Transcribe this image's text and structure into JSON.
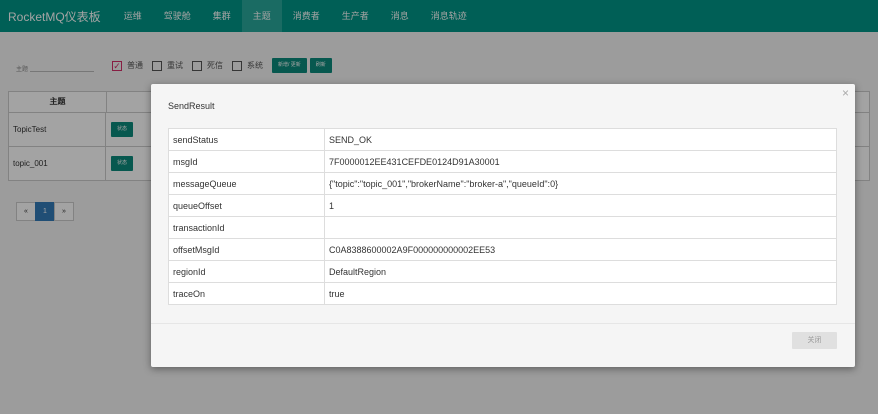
{
  "navbar": {
    "brand": "RocketMQ仪表板",
    "items": [
      "运维",
      "驾驶舱",
      "集群",
      "主题",
      "消费者",
      "生产者",
      "消息",
      "消息轨迹"
    ],
    "active_index": 3
  },
  "toolbar": {
    "topic_label": "主题",
    "topic_value": "",
    "filters": [
      {
        "label": "普通",
        "checked": true
      },
      {
        "label": "重试",
        "checked": false
      },
      {
        "label": "死信",
        "checked": false
      },
      {
        "label": "系统",
        "checked": false
      }
    ],
    "add_update_label": "新增/ 更新",
    "refresh_label": "刷新"
  },
  "topic_table": {
    "header": "主题",
    "rows": [
      {
        "name": "TopicTest",
        "status_label": "状态"
      },
      {
        "name": "topic_001",
        "status_label": "状态"
      }
    ]
  },
  "pagination": {
    "prev": "«",
    "current": "1",
    "next": "»"
  },
  "modal": {
    "title": "SendResult",
    "close_icon": "×",
    "rows": [
      {
        "key": "sendStatus",
        "value": "SEND_OK"
      },
      {
        "key": "msgId",
        "value": "7F0000012EE431CEFDE0124D91A30001"
      },
      {
        "key": "messageQueue",
        "value": "{\"topic\":\"topic_001\",\"brokerName\":\"broker-a\",\"queueId\":0}"
      },
      {
        "key": "queueOffset",
        "value": "1"
      },
      {
        "key": "transactionId",
        "value": ""
      },
      {
        "key": "offsetMsgId",
        "value": "C0A8388600002A9F000000000002EE53"
      },
      {
        "key": "regionId",
        "value": "DefaultRegion"
      },
      {
        "key": "traceOn",
        "value": "true"
      }
    ],
    "close_button_label": "关闭"
  },
  "colors": {
    "navbar": "#009587",
    "accent_button": "#0b8a7c",
    "checked": "#d32f6a"
  }
}
